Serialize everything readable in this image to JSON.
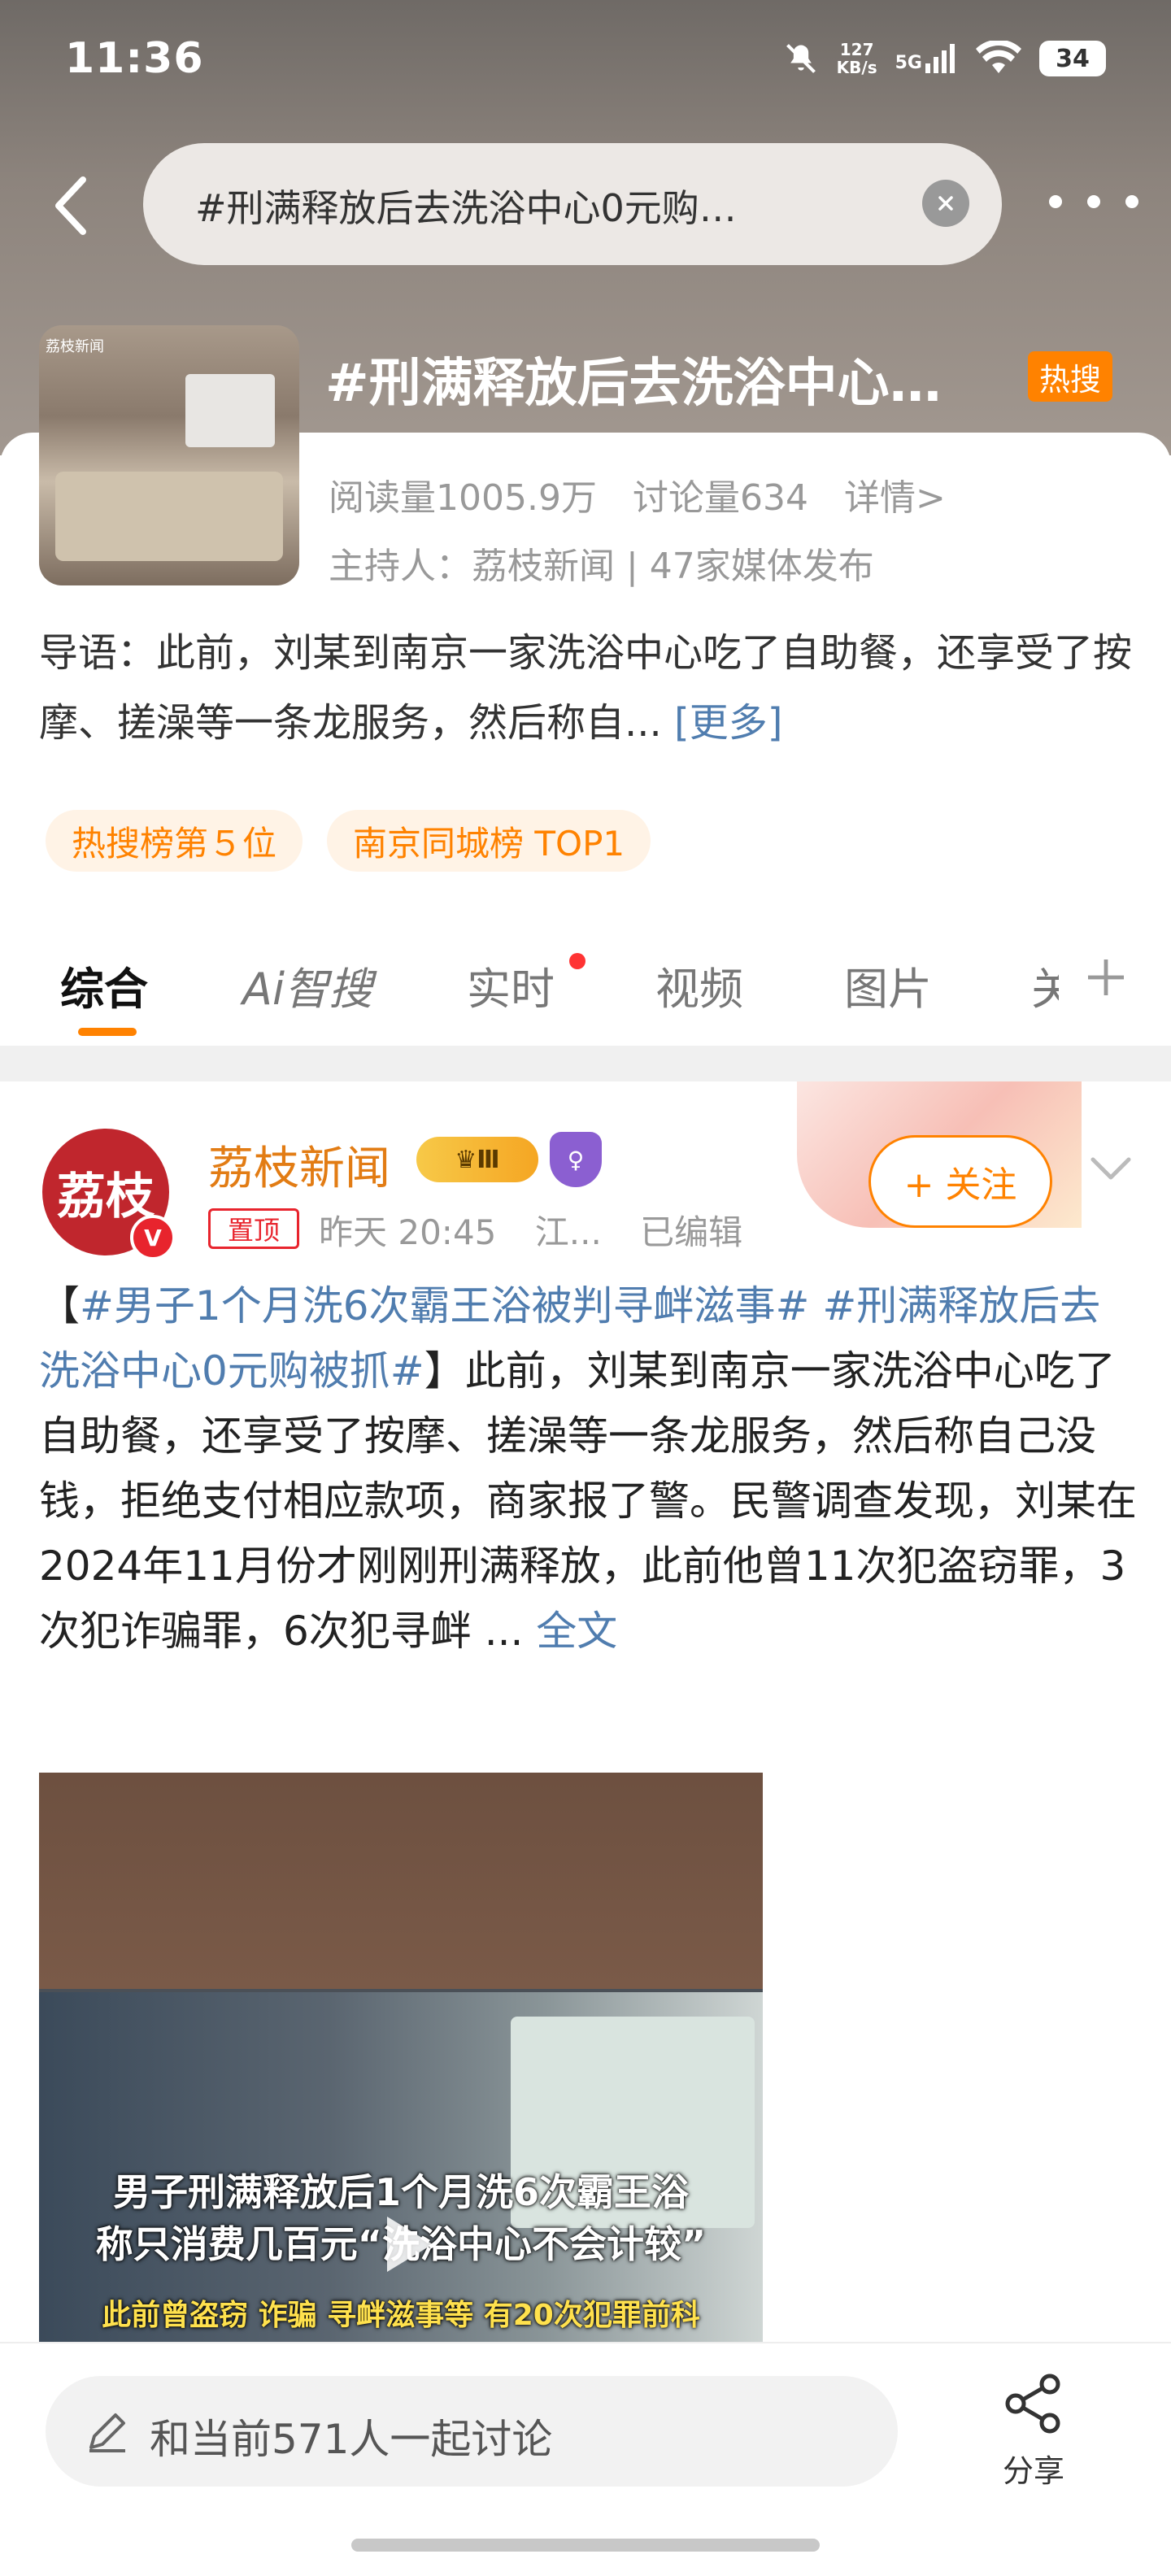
{
  "status_bar": {
    "time": "11:36",
    "net_speed_value": "127",
    "net_speed_unit": "KB/s",
    "signal_label": "5G",
    "battery": "34",
    "icons": [
      "mute-icon",
      "signal-icon",
      "wifi-icon",
      "battery-icon"
    ]
  },
  "search": {
    "query": "#刑满释放后去洗浴中心0元购…"
  },
  "topic": {
    "title": "#刑满释放后去洗浴中心…",
    "hot_badge": "热搜",
    "read_count": "阅读量1005.9万",
    "discuss_count": "讨论量634",
    "details_link": "详情>",
    "host": "主持人：荔枝新闻 | 47家媒体发布",
    "thumb_label": "荔枝新闻",
    "intro": "导语：此前，刘某到南京一家洗浴中心吃了自助餐，还享受了按摩、搓澡等一条龙服务，然后称自...",
    "intro_more": "[更多]",
    "tags": [
      "热搜榜第５位",
      "南京同城榜 TOP1"
    ]
  },
  "tabs": [
    {
      "label": "综合",
      "active": true
    },
    {
      "label": "Ai智搜",
      "active": false
    },
    {
      "label": "实时",
      "active": false,
      "has_dot": true
    },
    {
      "label": "视频",
      "active": false
    },
    {
      "label": "图片",
      "active": false
    },
    {
      "label": "关",
      "active": false
    }
  ],
  "post": {
    "avatar_text": "荔枝",
    "avatar_verified": "V",
    "author": "荔枝新闻",
    "crown_badge": "Ⅲ",
    "shield_badge": "♀",
    "pinned_label": "置顶",
    "time": "昨天 20:45",
    "location": "江...",
    "edited": "已编辑",
    "follow_label": "+ 关注",
    "body_prefix": "【",
    "hashtag1": "#男子1个月洗6次霸王浴被判寻衅滋事#",
    "hashtag2": "#刑满释放后去洗浴中心0元购被抓#",
    "body_text": "】此前，刘某到南京一家洗浴中心吃了自助餐，还享受了按摩、搓澡等一条龙服务，然后称自己没钱，拒绝支付相应款项，商家报了警。民警调查发现，刘某在2024年11月份才刚刚刑满释放，此前他曾11次犯盗窃罪，3次犯诈骗罪，6次犯寻衅 ... ",
    "full_text_link": "全文",
    "video_caption_line1": "男子刑满释放后1个月洗6次霸王浴",
    "video_caption_line2": "称只消费几百元“洗浴中心不会计较”",
    "video_caption_line3": "此前曾盗窃 诈骗 寻衅滋事等 有20次犯罪前科"
  },
  "bottom_bar": {
    "comment_placeholder": "和当前571人一起讨论",
    "share_label": "分享"
  },
  "colors": {
    "accent": "#ff8200",
    "link": "#507daf",
    "verified_red": "#e8242d"
  }
}
